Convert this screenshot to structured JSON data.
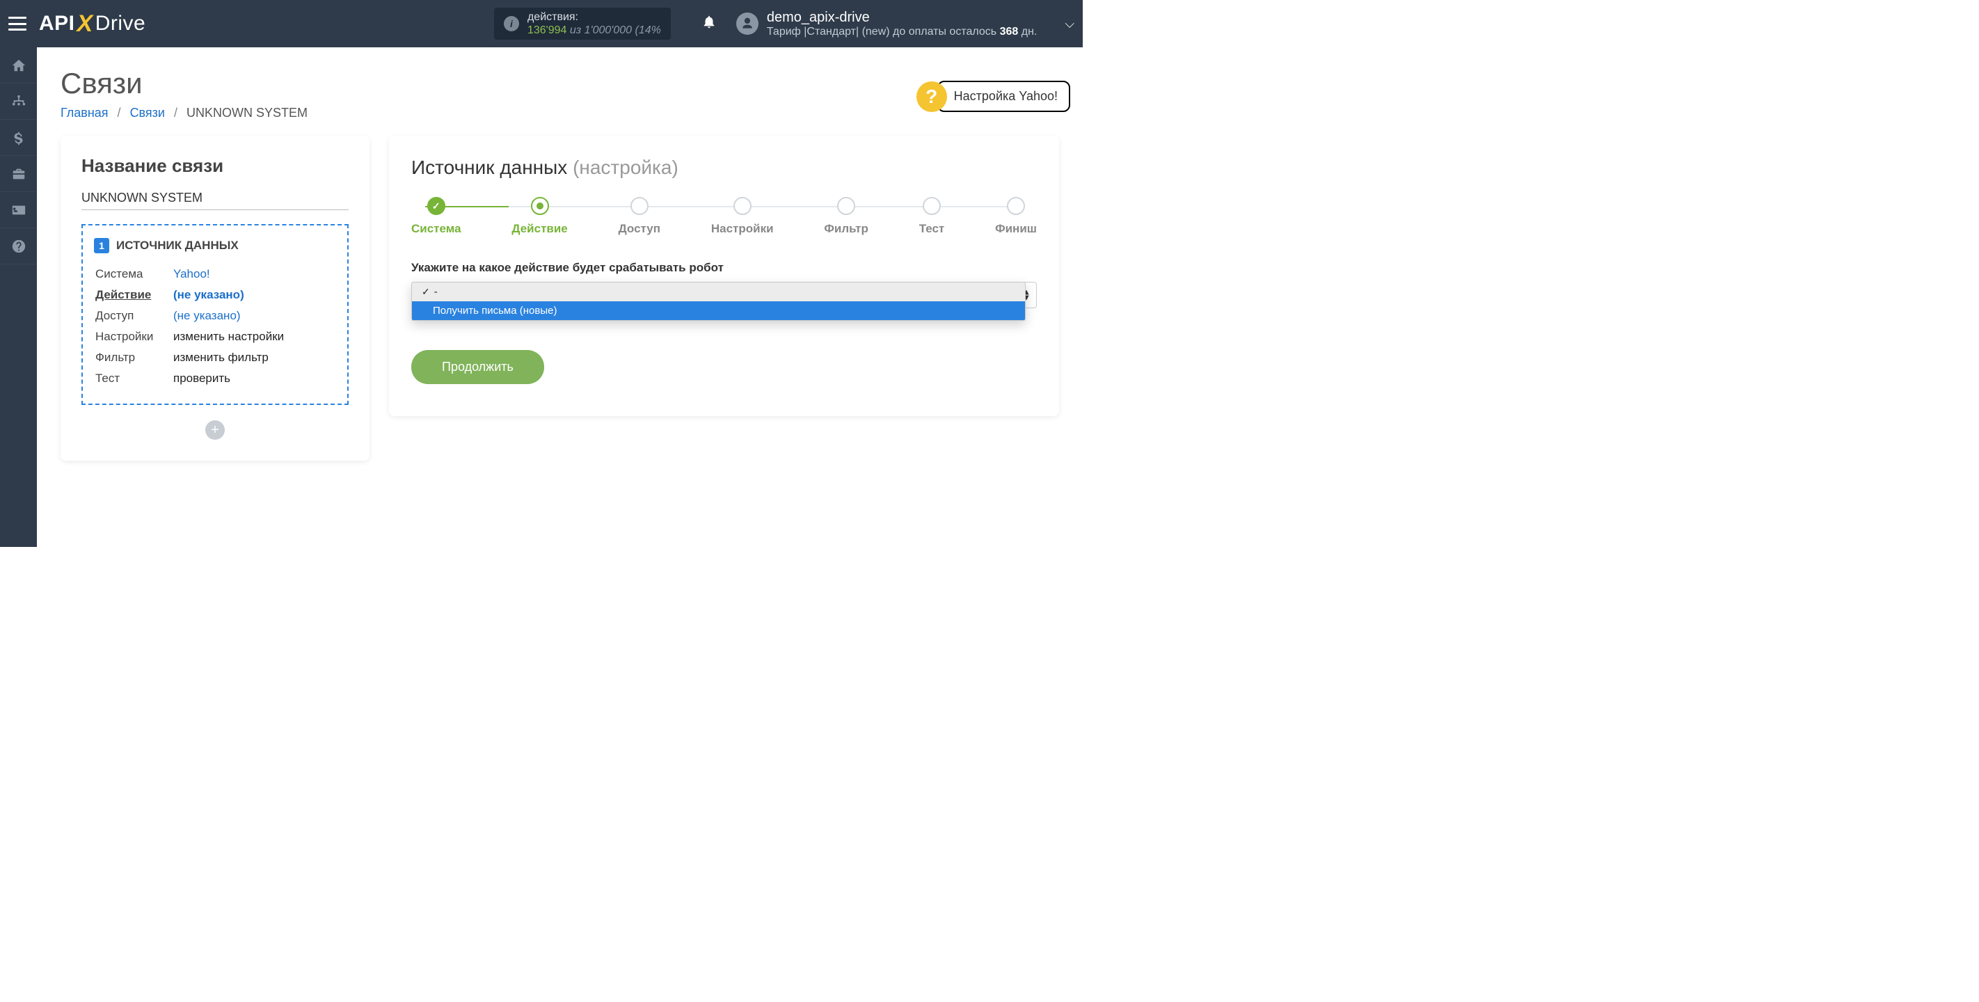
{
  "topbar": {
    "actions_label": "действия:",
    "actions_value": "136'994",
    "actions_of": "из",
    "actions_total": "1'000'000",
    "actions_tail": "(14%",
    "username": "demo_apix-drive",
    "plan_prefix": "Тариф |Стандарт| (new) до оплаты осталось ",
    "plan_days": "368",
    "plan_suffix": " дн."
  },
  "page": {
    "title": "Связи",
    "breadcrumb": {
      "home": "Главная",
      "links": "Связи",
      "current": "UNKNOWN SYSTEM"
    },
    "help": "Настройка Yahoo!"
  },
  "left": {
    "heading": "Название связи",
    "name_value": "UNKNOWN SYSTEM",
    "source_header": "ИСТОЧНИК ДАННЫХ",
    "rows": {
      "system_label": "Система",
      "system_value": "Yahoo!",
      "action_label": "Действие",
      "action_value": "(не указано)",
      "access_label": "Доступ",
      "access_value": "(не указано)",
      "settings_label": "Настройки",
      "settings_value": "изменить настройки",
      "filter_label": "Фильтр",
      "filter_value": "изменить фильтр",
      "test_label": "Тест",
      "test_value": "проверить"
    }
  },
  "right": {
    "heading_main": "Источник данных ",
    "heading_sub": "(настройка)",
    "steps": [
      "Система",
      "Действие",
      "Доступ",
      "Настройки",
      "Фильтр",
      "Тест",
      "Финиш"
    ],
    "field_label": "Укажите на какое действие будет срабатывать робот",
    "dropdown": {
      "opt_blank": "-",
      "opt_1": "Получить письма (новые)"
    },
    "continue": "Продолжить"
  }
}
